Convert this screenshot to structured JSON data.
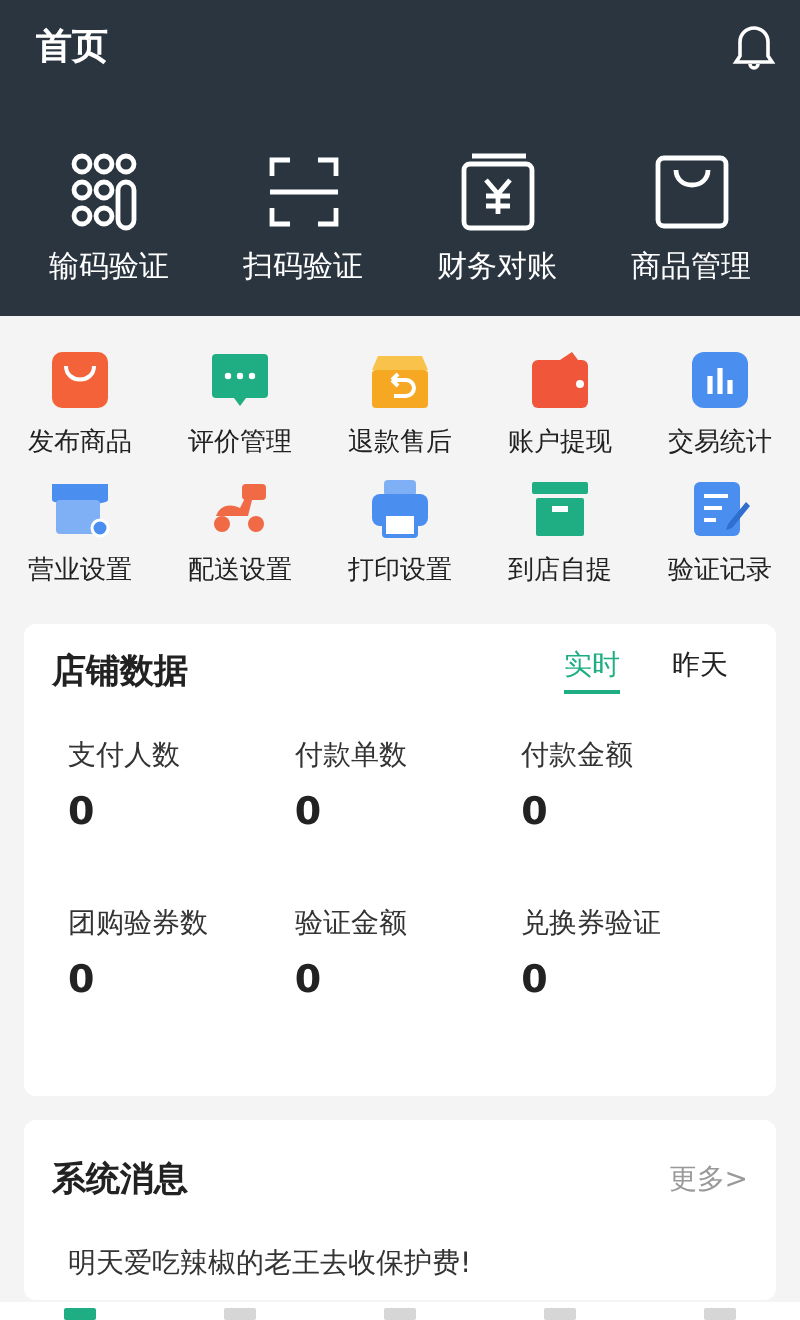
{
  "header": {
    "title": "首页"
  },
  "quick_actions": [
    {
      "label": "输码验证",
      "kind": "keypad"
    },
    {
      "label": "扫码验证",
      "kind": "scan"
    },
    {
      "label": "财务对账",
      "kind": "wallet"
    },
    {
      "label": "商品管理",
      "kind": "bag"
    }
  ],
  "tools": [
    {
      "label": "发布商品",
      "kind": "bag",
      "color": "#f4623a"
    },
    {
      "label": "评价管理",
      "kind": "chat",
      "color": "#1fae83"
    },
    {
      "label": "退款售后",
      "kind": "box",
      "color": "#f7a823"
    },
    {
      "label": "账户提现",
      "kind": "wallet",
      "color": "#f0573a"
    },
    {
      "label": "交易统计",
      "kind": "chart",
      "color": "#4a8ef0"
    },
    {
      "label": "营业设置",
      "kind": "shop",
      "color": "#4a8ef0"
    },
    {
      "label": "配送设置",
      "kind": "scooter",
      "color": "#ef6a45"
    },
    {
      "label": "打印设置",
      "kind": "printer",
      "color": "#4a8ef0"
    },
    {
      "label": "到店自提",
      "kind": "archive",
      "color": "#1fae83"
    },
    {
      "label": "验证记录",
      "kind": "note",
      "color": "#4a8ef0"
    }
  ],
  "store_data": {
    "title": "店铺数据",
    "tabs": [
      {
        "label": "实时",
        "selected": true
      },
      {
        "label": "昨天",
        "selected": false
      }
    ],
    "stats": [
      {
        "label": "支付人数",
        "value": "0"
      },
      {
        "label": "付款单数",
        "value": "0"
      },
      {
        "label": "付款金额",
        "value": "0"
      },
      {
        "label": "团购验券数",
        "value": "0"
      },
      {
        "label": "验证金额",
        "value": "0"
      },
      {
        "label": "兑换券验证",
        "value": "0"
      }
    ]
  },
  "system_messages": {
    "title": "系统消息",
    "more": "更多>",
    "messages": [
      "明天爱吃辣椒的老王去收保护费!"
    ]
  }
}
